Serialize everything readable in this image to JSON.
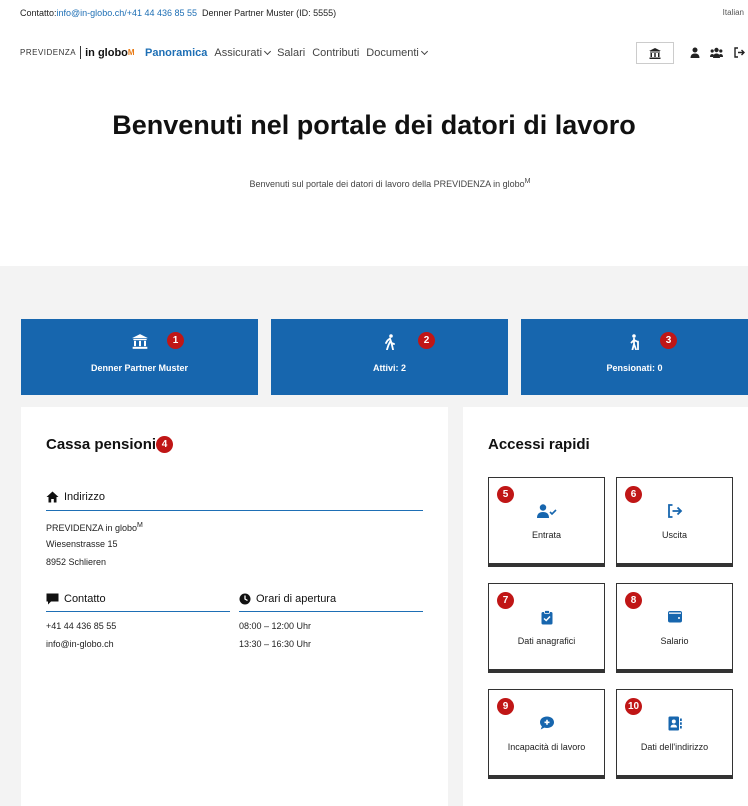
{
  "topbar": {
    "contact_label": "Contatto:",
    "email": "info@in-globo.ch",
    "phone": " /+41 44 436 85 55",
    "partner": "Denner Partner Muster (ID: 5555)",
    "language": "Italian"
  },
  "logo": {
    "brand": "PREVIDENZA",
    "name": "in globo",
    "mark": "M"
  },
  "menu": {
    "panoramica": "Panoramica",
    "assicurati": "Assicurati",
    "salari": "Salari",
    "contributi": "Contributi",
    "documenti": "Documenti"
  },
  "page": {
    "title": "Benvenuti nel portale dei datori di lavoro",
    "subtitle": "Benvenuti sul portale dei datori di lavoro della PREVIDENZA in globo",
    "subtitle_mark": "M"
  },
  "tiles": [
    {
      "label": "Denner Partner Muster",
      "badge": "1",
      "icon": "bank-icon"
    },
    {
      "label": "Attivi: 2",
      "badge": "2",
      "icon": "walking-person-icon"
    },
    {
      "label": "Pensionati: 0",
      "badge": "3",
      "icon": "elderly-person-icon"
    }
  ],
  "cassa": {
    "title": "Cassa pensioni",
    "badge": "4",
    "address_heading": "Indirizzo",
    "address_line1": "PREVIDENZA in globo",
    "address_line1_mark": "M",
    "address_line2": "Wiesenstrasse 15",
    "address_line3": "8952 Schlieren",
    "contact_heading": "Contatto",
    "phone": "+41 44 436 85 55",
    "email": "info@in-globo.ch",
    "hours_heading": "Orari di apertura",
    "hours1": "08:00 – 12:00 Uhr",
    "hours2": "13:30 – 16:30 Uhr"
  },
  "quick": {
    "title": "Accessi rapidi",
    "items": [
      {
        "label": "Entrata",
        "badge": "5",
        "icon": "user-check-icon"
      },
      {
        "label": "Uscita",
        "badge": "6",
        "icon": "sign-out-icon"
      },
      {
        "label": "Dati anagrafici",
        "badge": "7",
        "icon": "clipboard-check-icon"
      },
      {
        "label": "Salario",
        "badge": "8",
        "icon": "wallet-icon"
      },
      {
        "label": "Incapacità di lavoro",
        "badge": "9",
        "icon": "comment-medical-icon"
      },
      {
        "label": "Dati dell'indirizzo",
        "badge": "10",
        "icon": "address-book-icon"
      }
    ]
  },
  "colors": {
    "primary": "#1766ae",
    "link": "#1e6fb5",
    "badge": "#c01616",
    "accent": "#e87b16",
    "background_gray": "#f3f3f3"
  }
}
